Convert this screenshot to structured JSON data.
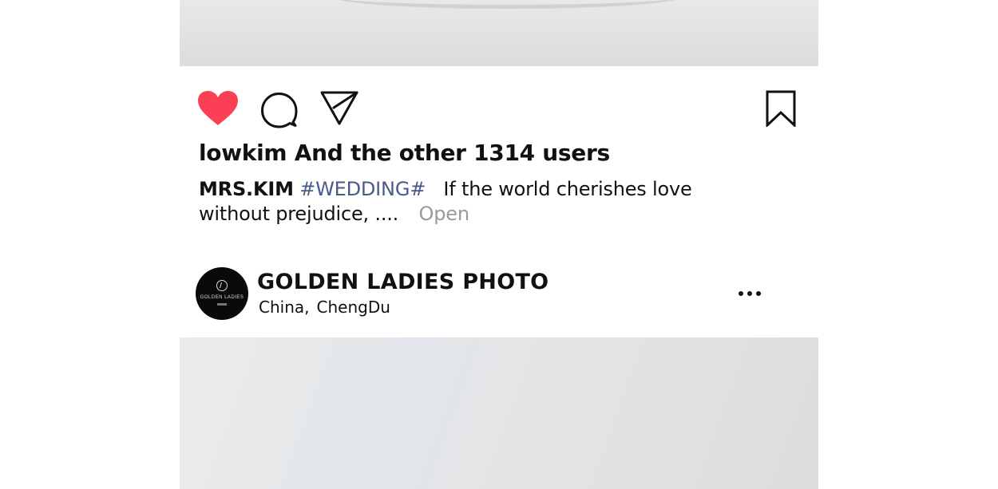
{
  "post_top": {
    "likes_text": "lowkim And the other 1314 users",
    "caption": {
      "author": "MRS.KIM",
      "hashtag": "#WEDDING#",
      "text": "If the world cherishes love without prejudice, ....",
      "more_label": "Open"
    },
    "liked": true
  },
  "next_post": {
    "account_name": "GOLDEN LADIES PHOTO",
    "location_country": "China,",
    "location_city": "ChengDu",
    "avatar_brand_text": "GOLDEN LADIES"
  },
  "icons": {
    "like": "heart-icon",
    "comment": "comment-bubble-icon",
    "share": "send-paper-plane-icon",
    "save": "bookmark-icon",
    "more": "more-options-icon"
  },
  "colors": {
    "heart": "#fb4055",
    "hashtag": "#4a5a8c",
    "muted": "#9a9a9a",
    "text": "#111111"
  }
}
